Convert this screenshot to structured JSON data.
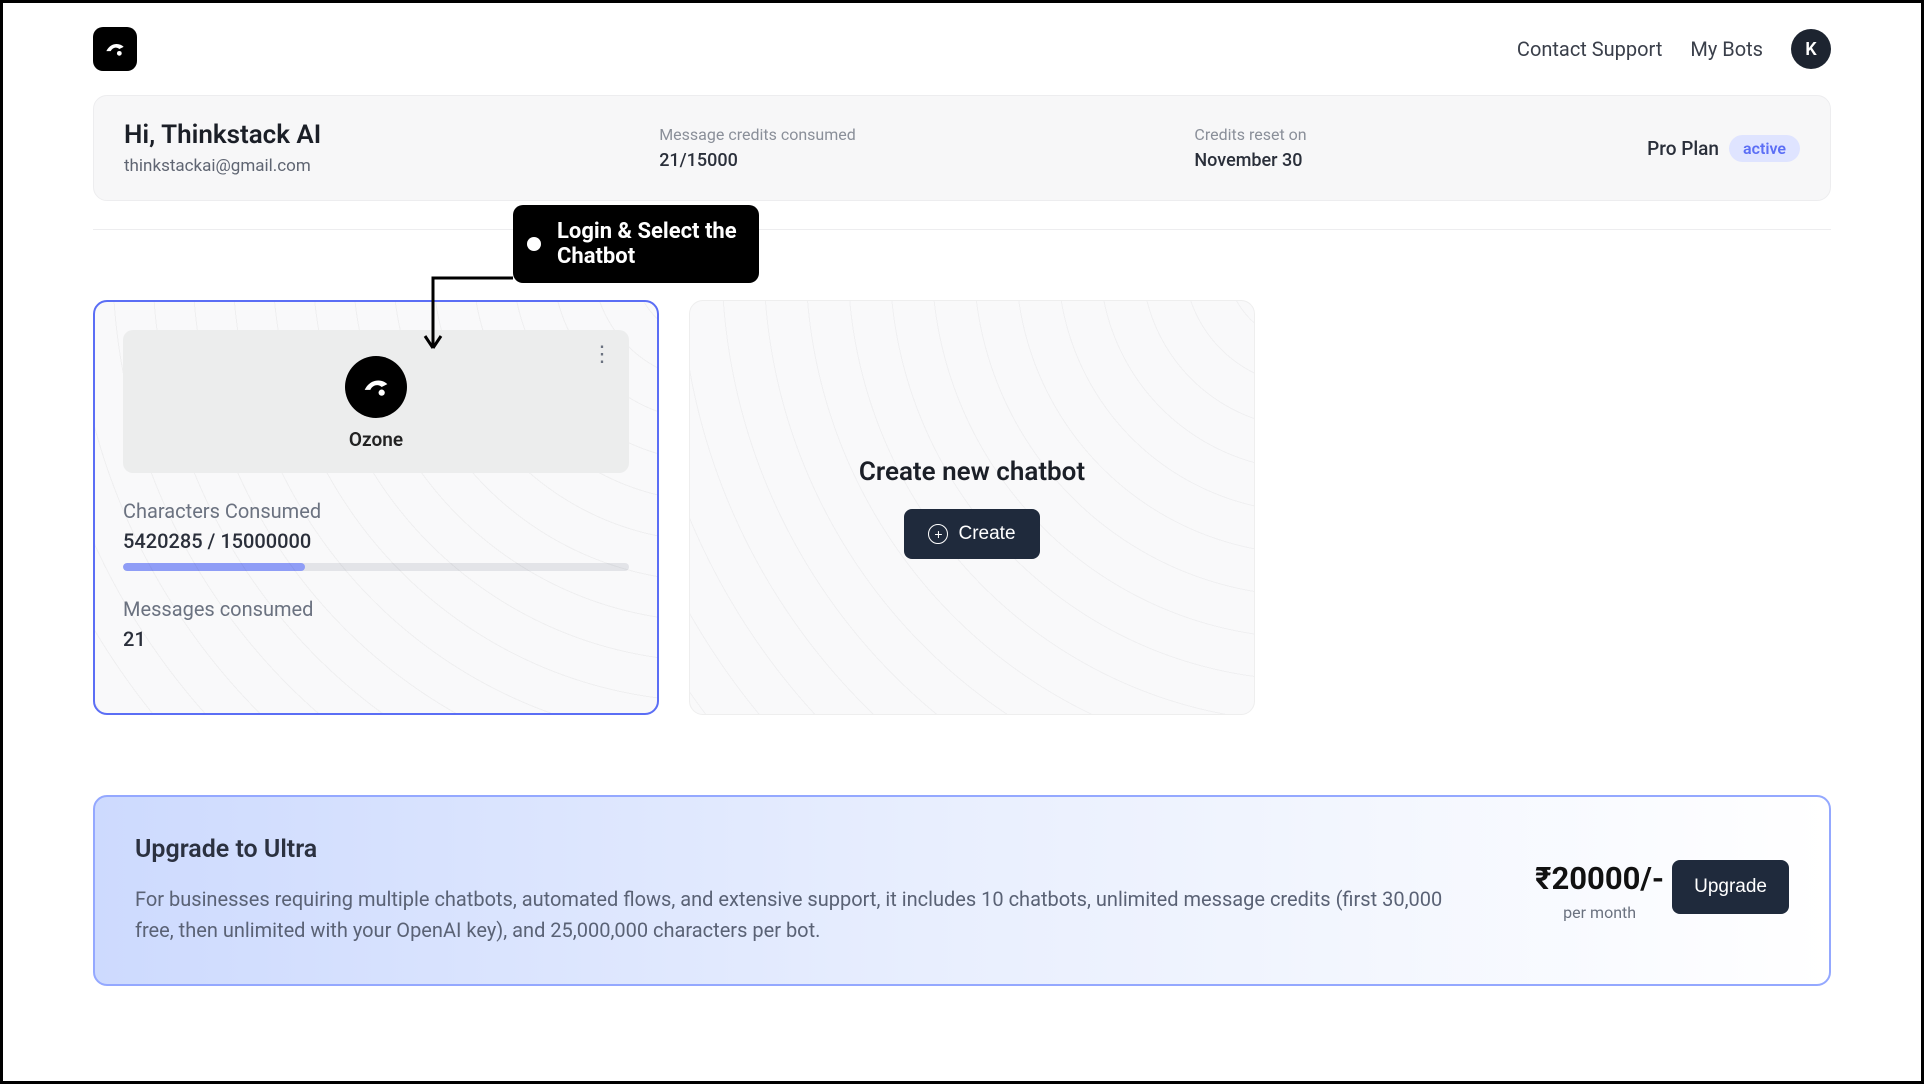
{
  "header": {
    "contact_support": "Contact Support",
    "my_bots": "My Bots",
    "avatar_initial": "K"
  },
  "greeting": {
    "title": "Hi, Thinkstack AI",
    "email": "thinkstackai@gmail.com"
  },
  "credits": {
    "label": "Message credits consumed",
    "value": "21/15000"
  },
  "reset": {
    "label": "Credits reset on",
    "value": "November 30"
  },
  "plan": {
    "name": "Pro Plan",
    "status": "active"
  },
  "bot": {
    "name": "Ozone",
    "chars_label": "Characters Consumed",
    "chars_value": "5420285 / 15000000",
    "msgs_label": "Messages consumed",
    "msgs_value": "21"
  },
  "create": {
    "title": "Create new chatbot",
    "button": "Create"
  },
  "upgrade": {
    "title": "Upgrade to Ultra",
    "desc": "For businesses requiring multiple chatbots, automated flows, and extensive support, it includes 10 chatbots, unlimited message credits (first 30,000 free, then unlimited with your OpenAI key), and 25,000,000 characters per bot.",
    "price": "₹20000/-",
    "per": "per month",
    "button": "Upgrade"
  },
  "annotation": {
    "line1": "Login & Select the",
    "line2": "Chatbot"
  }
}
